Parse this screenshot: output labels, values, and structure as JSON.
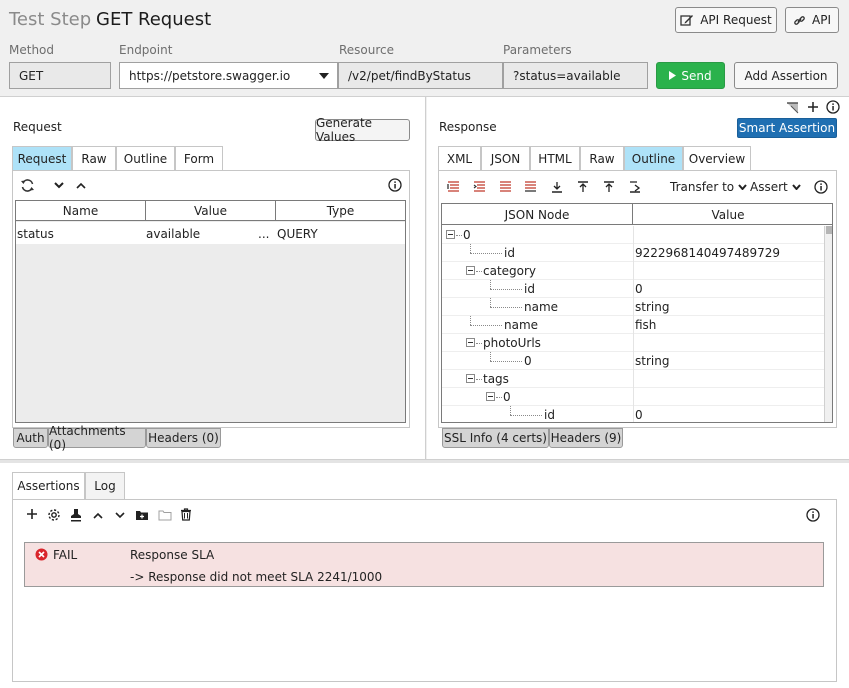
{
  "header": {
    "prefix": "Test Step",
    "title": "GET Request",
    "api_request_label": "API Request",
    "api_label": "API"
  },
  "request_bar": {
    "method_label": "Method",
    "endpoint_label": "Endpoint",
    "resource_label": "Resource",
    "parameters_label": "Parameters",
    "method_value": "GET",
    "endpoint_value": "https://petstore.swagger.io",
    "resource_value": "/v2/pet/findByStatus",
    "parameters_value": "?status=available",
    "send_label": "Send",
    "add_assertion_label": "Add Assertion"
  },
  "colors": {
    "send_green": "#2bb24c",
    "smart_blue": "#1f6fb2",
    "tab_active": "#aee2f8",
    "fail_bg": "#f6e1e1",
    "fail_icon": "#d9262c"
  },
  "request": {
    "title": "Request",
    "generate_values_label": "Generate Values",
    "tabs": [
      "Request",
      "Raw",
      "Outline",
      "Form"
    ],
    "active_tab": "Request",
    "columns": [
      "Name",
      "Value",
      "Type"
    ],
    "rows": [
      {
        "name": "status",
        "value": "available",
        "more": "...",
        "type": "QUERY"
      }
    ],
    "bottom_tabs": [
      "Auth",
      "Attachments (0)",
      "Headers (0)"
    ],
    "toolbar_icons": [
      "refresh-icon",
      "chevron-down-icon",
      "chevron-up-icon",
      "info-icon"
    ]
  },
  "response": {
    "title": "Response",
    "smart_assertion_label": "Smart Assertion",
    "tabs": [
      "XML",
      "JSON",
      "HTML",
      "Raw",
      "Outline",
      "Overview"
    ],
    "active_tab": "Outline",
    "transfer_label": "Transfer to",
    "assert_label": "Assert",
    "columns": [
      "JSON Node",
      "Value"
    ],
    "tree": [
      {
        "label": "0",
        "value": "",
        "level": 0,
        "toggle": "minus"
      },
      {
        "label": "id",
        "value": "9222968140497489729",
        "level": 1,
        "toggle": ""
      },
      {
        "label": "category",
        "value": "",
        "level": 1,
        "toggle": "minus"
      },
      {
        "label": "id",
        "value": "0",
        "level": 2,
        "toggle": ""
      },
      {
        "label": "name",
        "value": "string",
        "level": 2,
        "toggle": ""
      },
      {
        "label": "name",
        "value": "fish",
        "level": 1,
        "toggle": ""
      },
      {
        "label": "photoUrls",
        "value": "",
        "level": 1,
        "toggle": "minus"
      },
      {
        "label": "0",
        "value": "string",
        "level": 2,
        "toggle": ""
      },
      {
        "label": "tags",
        "value": "",
        "level": 1,
        "toggle": "minus"
      },
      {
        "label": "0",
        "value": "",
        "level": 2,
        "toggle": "minus"
      },
      {
        "label": "id",
        "value": "0",
        "level": 3,
        "toggle": ""
      }
    ],
    "bottom_tabs": [
      "SSL Info (4 certs)",
      "Headers (9)"
    ]
  },
  "assertions": {
    "tabs": [
      "Assertions",
      "Log"
    ],
    "active_tab": "Assertions",
    "items": [
      {
        "status": "FAIL",
        "name": "Response SLA",
        "message": "-> Response did not meet SLA 2241/1000"
      }
    ]
  }
}
